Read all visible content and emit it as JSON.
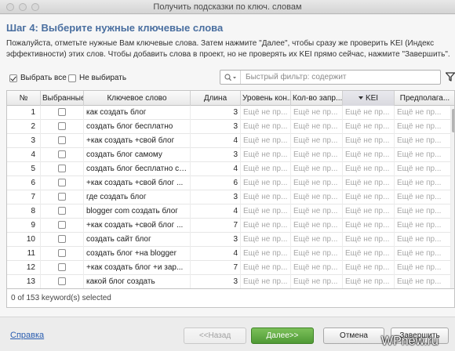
{
  "window": {
    "title": "Получить подсказки по ключ. словам"
  },
  "step_title": "Шаг 4: Выберите нужные ключевые слова",
  "instructions": "Пожалуйста, отметьте нужные Вам ключевые слова. Затем нажмите \"Далее\", чтобы сразу же проверить KEI (Индекс эффективности) этих слов. Чтобы добавить слова в проект, но не проверять их KEI прямо сейчас, нажмите \"Завершить\".",
  "toolbar": {
    "select_all_label": "Выбрать все",
    "select_all_checked": true,
    "select_none_label": "Не выбирать",
    "select_none_checked": false,
    "filter_placeholder": "Быстрый фильтр: содержит",
    "filter_value": ""
  },
  "table": {
    "columns": [
      "№",
      "Выбранные",
      "Ключевое слово",
      "Длина",
      "Уровень кон...",
      "Кол-во запр...",
      "KEI",
      "Предполага..."
    ],
    "sorted_column": "KEI",
    "placeholder": "Ещё не пр...",
    "rows": [
      {
        "num": "1",
        "keyword": "как создать блог",
        "length": "3"
      },
      {
        "num": "2",
        "keyword": "создать блог бесплатно",
        "length": "3"
      },
      {
        "num": "3",
        "keyword": "+как создать +свой блог",
        "length": "4"
      },
      {
        "num": "4",
        "keyword": "создать блог самому",
        "length": "3"
      },
      {
        "num": "5",
        "keyword": "создать блог бесплатно са...",
        "length": "4"
      },
      {
        "num": "6",
        "keyword": "+как создать +свой блог ...",
        "length": "6"
      },
      {
        "num": "7",
        "keyword": "где создать блог",
        "length": "3"
      },
      {
        "num": "8",
        "keyword": "blogger com создать блог",
        "length": "4"
      },
      {
        "num": "9",
        "keyword": "+как создать +свой блог ...",
        "length": "7"
      },
      {
        "num": "10",
        "keyword": "создать сайт блог",
        "length": "3"
      },
      {
        "num": "11",
        "keyword": "создать блог +на blogger",
        "length": "4"
      },
      {
        "num": "12",
        "keyword": "+как создать блог +и зар...",
        "length": "7"
      },
      {
        "num": "13",
        "keyword": "какой блог создать",
        "length": "3"
      }
    ]
  },
  "status": "0 of 153 keyword(s) selected",
  "footer": {
    "help_label": "Справка",
    "back_label": "<<Назад",
    "next_label": "Далее>>",
    "cancel_label": "Отмена",
    "finish_label": "Завершить"
  },
  "watermark": "WPnew.ru",
  "colors": {
    "accent": "#4a6fa0",
    "primary_button": "#5aa83c",
    "link": "#2a5db0",
    "placeholder_text": "#a8a8a8"
  }
}
